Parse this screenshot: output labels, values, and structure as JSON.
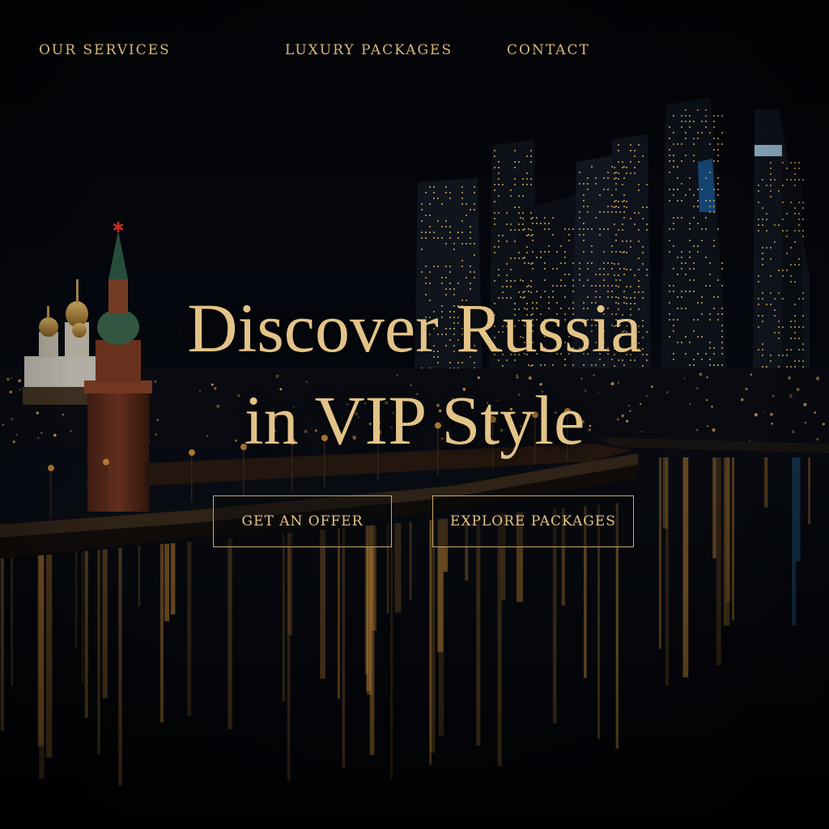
{
  "nav": {
    "items": [
      {
        "label": "OUR SERVICES"
      },
      {
        "label": "LUXURY PACKAGES"
      },
      {
        "label": "CONTACT"
      }
    ]
  },
  "hero": {
    "title_line1": "Discover Russia",
    "title_line2": "in VIP Style",
    "primary_cta": "GET AN OFFER",
    "secondary_cta": "EXPLORE PACKAGES"
  },
  "colors": {
    "accent_gold": "#d8b87a",
    "background": "#05070c",
    "river_light": "#e8a040",
    "tower_glow": "#3aa8ff"
  },
  "background_image": {
    "icons": [
      "kremlin-tower-icon",
      "cathedral-icon",
      "skyscraper-icon",
      "river-reflection-icon"
    ]
  }
}
